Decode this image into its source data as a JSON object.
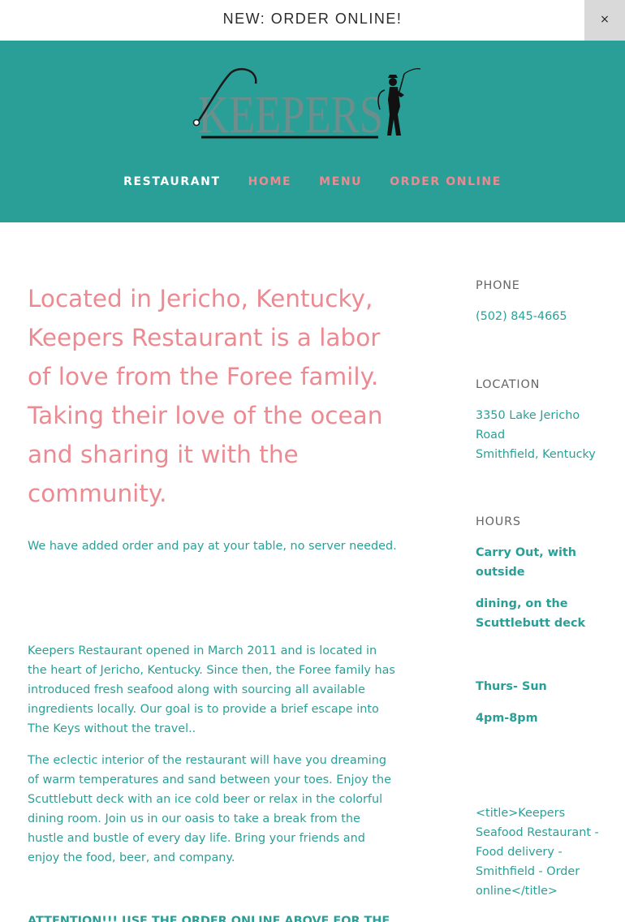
{
  "announcement": {
    "text": "NEW: ORDER ONLINE!",
    "close_icon": "×"
  },
  "header": {
    "logo_text": "KEEPERS",
    "colors": {
      "background": "#2a9f97",
      "logo": "#6b8f8d",
      "accent": "#ec8a92"
    }
  },
  "nav": {
    "items": [
      {
        "label": "RESTAURANT",
        "active": true
      },
      {
        "label": "HOME",
        "active": false
      },
      {
        "label": "MENU",
        "active": false
      },
      {
        "label": "ORDER ONLINE",
        "active": false
      }
    ]
  },
  "main": {
    "headline": "Located in Jericho, Kentucky, Keepers Restaurant is a labor of love from the Foree family. Taking their love of the ocean and sharing it with the community.",
    "order_note": "We have added order and pay at your table, no server needed.",
    "about_1": "Keepers Restaurant opened in March 2011 and is located in the heart of Jericho, Kentucky. Since then, the Foree family has introduced fresh seafood along with sourcing all available ingredients locally. Our goal is to provide a brief escape into The Keys without the travel..",
    "about_2": "The eclectic interior of the restaurant will have you dreaming of warm temperatures and sand between your toes. Enjoy the Scuttlebutt deck with an ice cold beer or relax in the colorful dining room. Join us in our oasis to take a break from the hustle and bustle of every day life. Bring your friends and enjoy the food, beer, and company.",
    "attention": "ATTENTION!!! USE THE ORDER ONLINE ABOVE FOR THE"
  },
  "sidebar": {
    "phone_label": "PHONE",
    "phone": "(502) 845-4665",
    "location_label": "LOCATION",
    "address_line1": "3350 Lake Jericho Road",
    "address_line2": "Smithfield, Kentucky",
    "hours_label": "HOURS",
    "hours_note_1": "Carry Out, with outside",
    "hours_note_2": "dining, on the Scuttlebutt deck",
    "hours_days": "Thurs- Sun",
    "hours_time": "4pm-8pm",
    "raw_title": "<title>Keepers Seafood Restaurant - Food delivery - Smithfield - Order online</title>"
  }
}
